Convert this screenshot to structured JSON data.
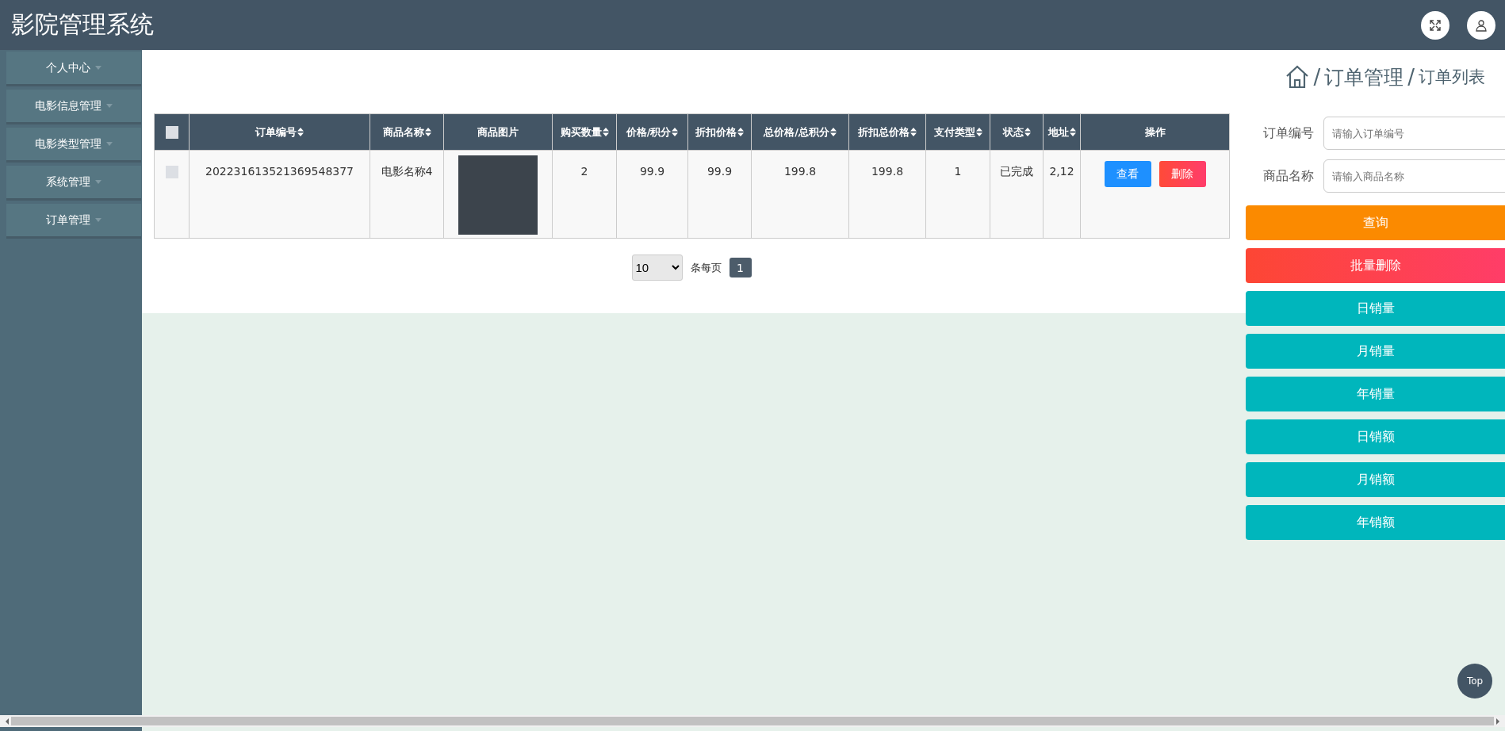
{
  "header": {
    "title": "影院管理系统"
  },
  "sidebar": {
    "items": [
      {
        "label": "个人中心"
      },
      {
        "label": "电影信息管理"
      },
      {
        "label": "电影类型管理"
      },
      {
        "label": "系统管理"
      },
      {
        "label": "订单管理"
      }
    ]
  },
  "breadcrumb": {
    "items": [
      {
        "kind": "separator",
        "text": "/"
      },
      {
        "kind": "link",
        "text": "订单管理"
      },
      {
        "kind": "separator",
        "text": "/"
      },
      {
        "kind": "current",
        "text": "订单列表"
      }
    ]
  },
  "table": {
    "columns": [
      {
        "kind": "check",
        "checked": false
      },
      {
        "kind": "text",
        "label": "订单编号",
        "sortable": true
      },
      {
        "kind": "text",
        "label": "商品名称",
        "sortable": true
      },
      {
        "kind": "text",
        "label": "商品图片",
        "sortable": false
      },
      {
        "kind": "text",
        "label": "购买数量",
        "sortable": true
      },
      {
        "kind": "text",
        "label": "价格/积分",
        "sortable": true
      },
      {
        "kind": "text",
        "label": "折扣价格",
        "sortable": true
      },
      {
        "kind": "text",
        "label": "总价格/总积分",
        "sortable": true
      },
      {
        "kind": "text",
        "label": "折扣总价格",
        "sortable": true
      },
      {
        "kind": "text",
        "label": "支付类型",
        "sortable": true
      },
      {
        "kind": "text",
        "label": "状态",
        "sortable": true
      },
      {
        "kind": "text",
        "label": "地址",
        "sortable": true
      },
      {
        "kind": "text",
        "label": "操作",
        "sortable": false
      }
    ],
    "rows": [
      {
        "cells": [
          {
            "kind": "check",
            "checked": false
          },
          {
            "kind": "text",
            "text": "202231613521369548377"
          },
          {
            "kind": "text",
            "text": "电影名称4"
          },
          {
            "kind": "image"
          },
          {
            "kind": "text",
            "text": "2"
          },
          {
            "kind": "text",
            "text": "99.9"
          },
          {
            "kind": "text",
            "text": "99.9"
          },
          {
            "kind": "text",
            "text": "199.8"
          },
          {
            "kind": "text",
            "text": "199.8"
          },
          {
            "kind": "text",
            "text": "1"
          },
          {
            "kind": "text",
            "text": "已完成"
          },
          {
            "kind": "text",
            "text": "2,12"
          },
          {
            "kind": "actions",
            "buttons": [
              {
                "kind": "view",
                "label": "查看"
              },
              {
                "kind": "delete",
                "label": "删除"
              }
            ]
          }
        ]
      }
    ]
  },
  "pagination": {
    "page_size": "10",
    "per_page_label": "条每页",
    "pages": [
      {
        "label": "1",
        "selected": true
      }
    ]
  },
  "search": {
    "fields": [
      {
        "label": "订单编号",
        "placeholder": "请输入订单编号"
      },
      {
        "label": "商品名称",
        "placeholder": "请输入商品名称"
      }
    ],
    "buttons": [
      {
        "kind": "search",
        "label": "查询"
      },
      {
        "kind": "delete",
        "label": "批量删除"
      },
      {
        "kind": "stat",
        "label": "日销量"
      },
      {
        "kind": "stat",
        "label": "月销量"
      },
      {
        "kind": "stat",
        "label": "年销量"
      },
      {
        "kind": "stat",
        "label": "日销额"
      },
      {
        "kind": "stat",
        "label": "月销额"
      },
      {
        "kind": "stat",
        "label": "年销额"
      }
    ]
  },
  "back_to_top": {
    "label": "Top"
  }
}
